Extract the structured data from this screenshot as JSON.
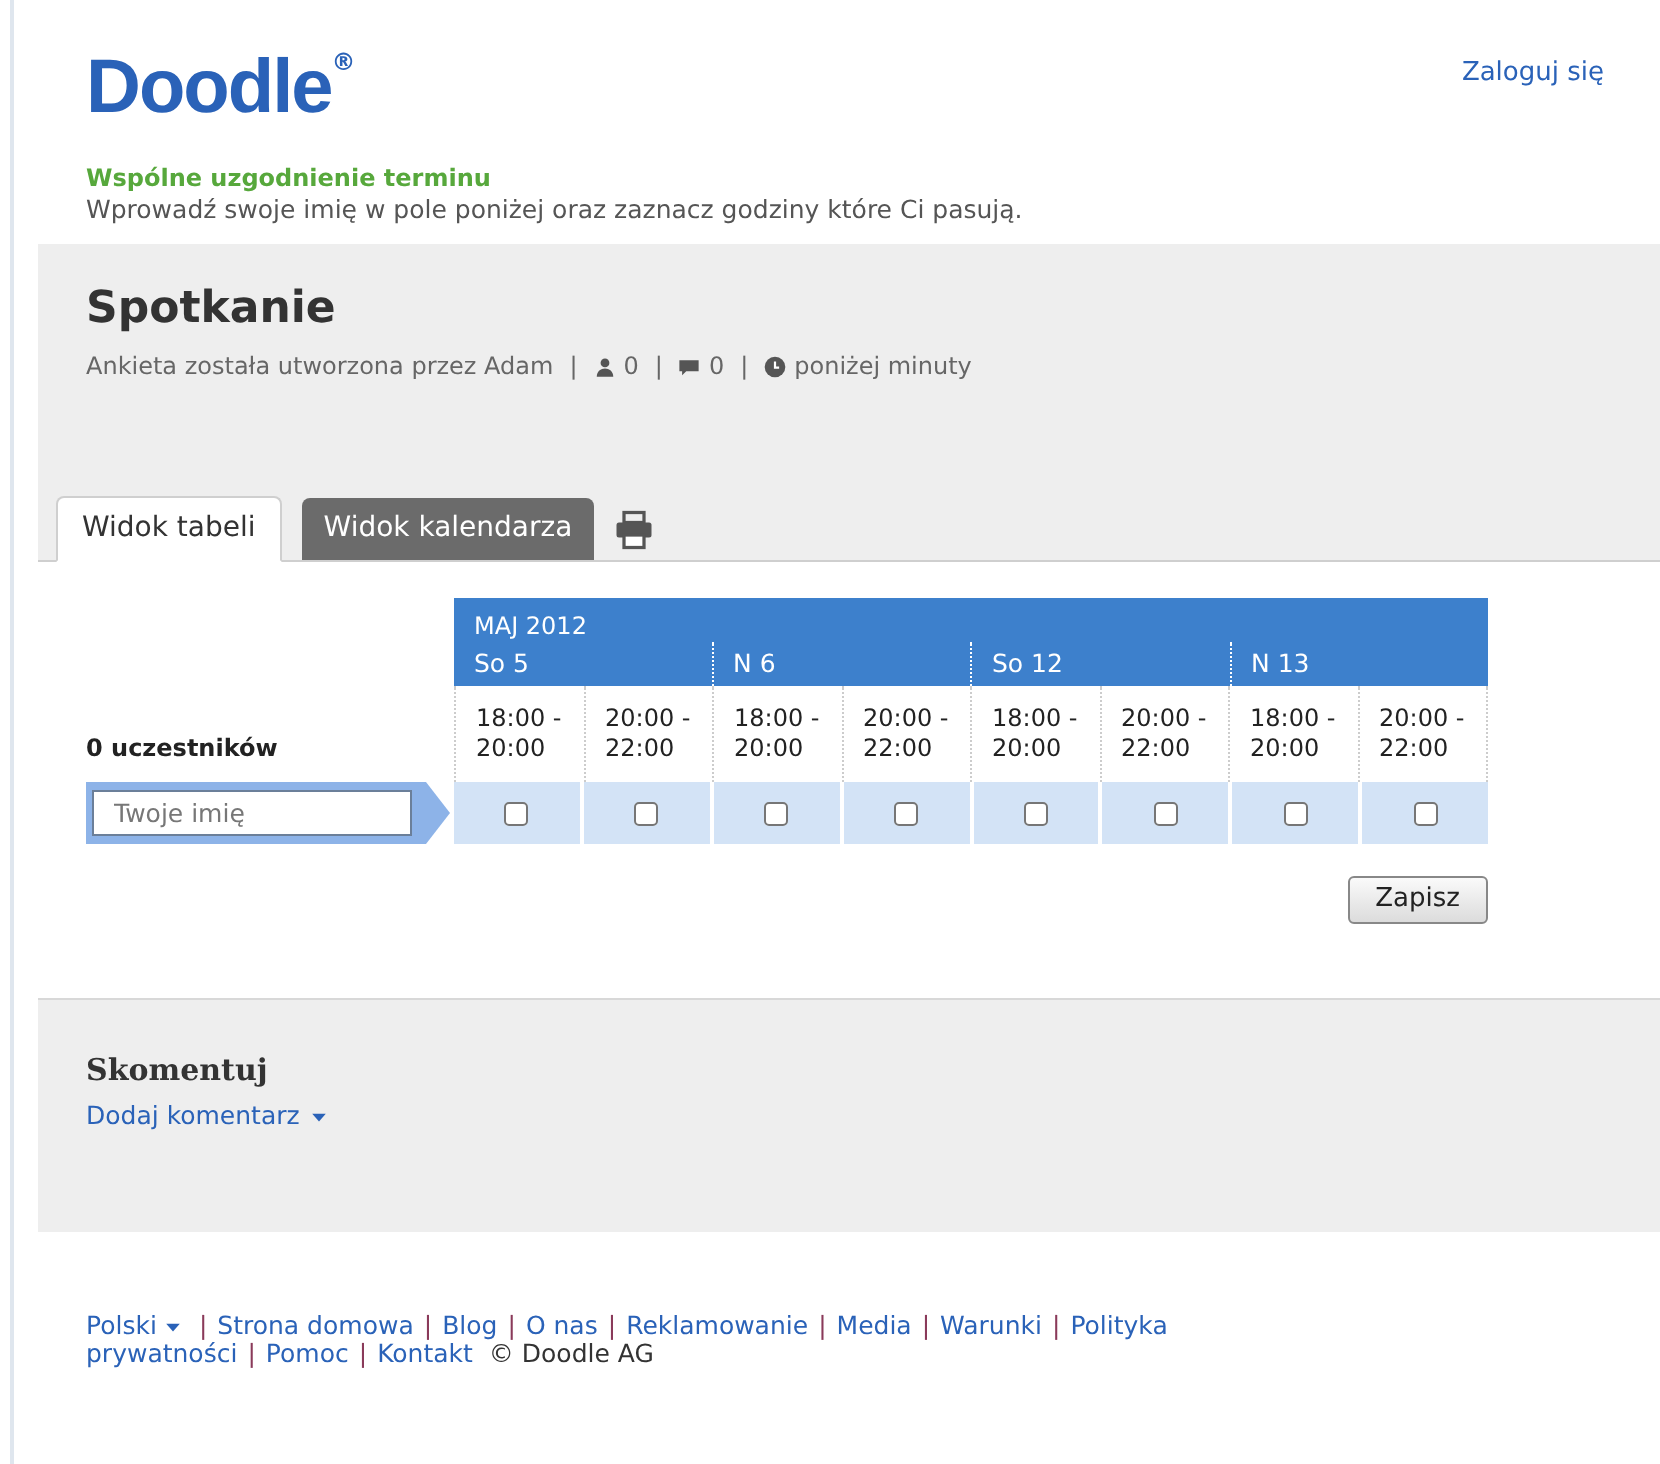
{
  "header": {
    "logo": "Doodle",
    "logo_mark": "®",
    "login_link": "Zaloguj się"
  },
  "intro": {
    "title": "Wspólne uzgodnienie terminu",
    "text": "Wprowadź swoje imię w pole poniżej oraz zaznacz godziny które Ci pasują."
  },
  "poll": {
    "separator": "|",
    "title": "Spotkanie",
    "author": "Ankieta została utworzona przez Adam",
    "participants": "0",
    "comments": "0",
    "time": "poniżej minuty"
  },
  "tabs": [
    {
      "label": "Widok tabeli",
      "selected": true
    },
    {
      "label": "Widok kalendarza",
      "selected": false
    }
  ],
  "table": {
    "month": "MAJ 2012",
    "participants_label": "0 uczestników",
    "name_field": {
      "placeholder": "Twoje imię"
    },
    "days": [
      {
        "label": "So 5",
        "slots": [
          {
            "time": "18:00 - 20:00",
            "checked": false
          },
          {
            "time": "20:00 - 22:00",
            "checked": false
          }
        ]
      },
      {
        "label": "N 6",
        "slots": [
          {
            "time": "18:00 - 20:00",
            "checked": false
          },
          {
            "time": "20:00 - 22:00",
            "checked": false
          }
        ]
      },
      {
        "label": "So 12",
        "slots": [
          {
            "time": "18:00 - 20:00",
            "checked": false
          },
          {
            "time": "20:00 - 22:00",
            "checked": false
          }
        ]
      },
      {
        "label": "N 13",
        "slots": [
          {
            "time": "18:00 - 20:00",
            "checked": false
          },
          {
            "time": "20:00 - 22:00",
            "checked": false
          }
        ]
      }
    ]
  },
  "save_button": "Zapisz",
  "comments": {
    "title": "Skomentuj",
    "add_link": "Dodaj komentarz"
  },
  "footer": {
    "separator": "|",
    "language": "Polski",
    "lines": [
      [
        "Strona domowa",
        "Blog",
        "O nas",
        "Reklamowanie",
        "Media",
        "Warunki",
        "Polityka"
      ],
      [
        "prywatności",
        "Pomoc",
        "Kontakt"
      ]
    ],
    "copyright": "© Doodle AG"
  }
}
